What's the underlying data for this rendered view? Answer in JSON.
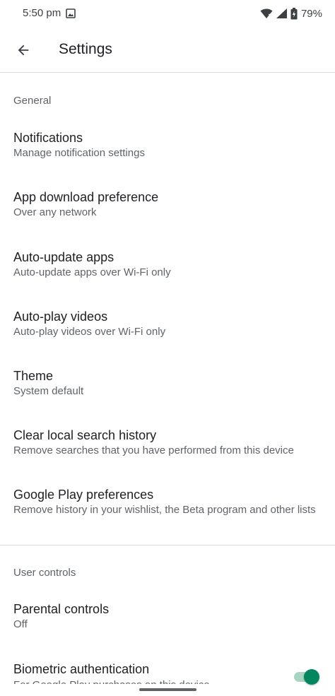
{
  "status_bar": {
    "time": "5:50 pm",
    "battery": "79%"
  },
  "app_bar": {
    "title": "Settings"
  },
  "sections": {
    "general": {
      "header": "General",
      "items": [
        {
          "title": "Notifications",
          "subtitle": "Manage notification settings"
        },
        {
          "title": "App download preference",
          "subtitle": "Over any network"
        },
        {
          "title": "Auto-update apps",
          "subtitle": "Auto-update apps over Wi-Fi only"
        },
        {
          "title": "Auto-play videos",
          "subtitle": "Auto-play videos over Wi-Fi only"
        },
        {
          "title": "Theme",
          "subtitle": "System default"
        },
        {
          "title": "Clear local search history",
          "subtitle": "Remove searches that you have performed from this device"
        },
        {
          "title": "Google Play preferences",
          "subtitle": "Remove history in your wishlist, the Beta program and other lists"
        }
      ]
    },
    "user_controls": {
      "header": "User controls",
      "items": [
        {
          "title": "Parental controls",
          "subtitle": "Off"
        },
        {
          "title": "Biometric authentication",
          "subtitle": "For Google Play purchases on this device",
          "toggle_on": true
        }
      ]
    }
  },
  "colors": {
    "accent": "#01875f",
    "accent_track": "#a8d4c2",
    "divider": "#dadce0",
    "secondary_text": "#5f6368"
  }
}
